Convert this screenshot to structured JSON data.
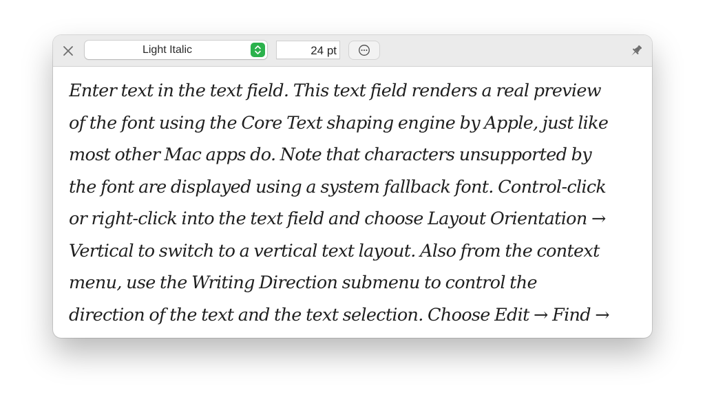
{
  "toolbar": {
    "close_icon": "close-icon",
    "style_select": {
      "value": "Light Italic",
      "stepper_icon": "up-down-chevron-icon",
      "accent": "#2bb24c"
    },
    "size_field": {
      "value": "24 pt"
    },
    "more_icon": "ellipsis-circle-icon",
    "pin_icon": "pin-icon"
  },
  "preview": {
    "lines": [
      "Enter text in the text field. This text field renders a real preview",
      "of the font using the Core Text shaping engine by Apple, just like",
      "most other Mac apps do. Note that characters unsupported by",
      "the font are displayed using a system fallback font. Control-click",
      "or right-click into the text field and choose Layout Orientation →",
      "Vertical to switch to a vertical text layout. Also from the context",
      "menu, use the Writing Direction submenu to control the",
      "direction of the text and the text selection. Choose Edit → Find →"
    ]
  }
}
